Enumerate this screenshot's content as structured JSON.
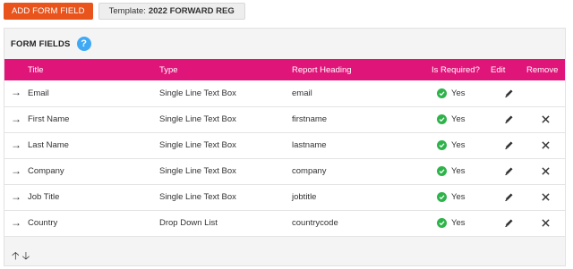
{
  "toolbar": {
    "add_label": "ADD FORM FIELD",
    "template_label": "Template:",
    "template_value": "2022 FORWARD REG"
  },
  "panel": {
    "title": "FORM FIELDS",
    "help_symbol": "?"
  },
  "table": {
    "headers": {
      "title": "Title",
      "type": "Type",
      "report": "Report Heading",
      "required": "Is Required?",
      "edit": "Edit",
      "remove": "Remove"
    },
    "rows": [
      {
        "title": "Email",
        "type": "Single Line Text Box",
        "report": "email",
        "required": "Yes",
        "removable": false
      },
      {
        "title": "First Name",
        "type": "Single Line Text Box",
        "report": "firstname",
        "required": "Yes",
        "removable": true
      },
      {
        "title": "Last Name",
        "type": "Single Line Text Box",
        "report": "lastname",
        "required": "Yes",
        "removable": true
      },
      {
        "title": "Company",
        "type": "Single Line Text Box",
        "report": "company",
        "required": "Yes",
        "removable": true
      },
      {
        "title": "Job Title",
        "type": "Single Line Text Box",
        "report": "jobtitle",
        "required": "Yes",
        "removable": true
      },
      {
        "title": "Country",
        "type": "Drop Down List",
        "report": "countrycode",
        "required": "Yes",
        "removable": true
      }
    ]
  },
  "icons": {
    "drag_handle": "right-arrow-icon",
    "required": "check-circle-icon",
    "edit": "pencil-icon",
    "remove": "close-icon",
    "sort_up": "up-arrow-icon",
    "sort_down": "down-arrow-icon"
  },
  "colors": {
    "accent": "#e8541c",
    "header": "#e0157a",
    "help": "#3fa9f5",
    "check": "#2eb34a"
  }
}
